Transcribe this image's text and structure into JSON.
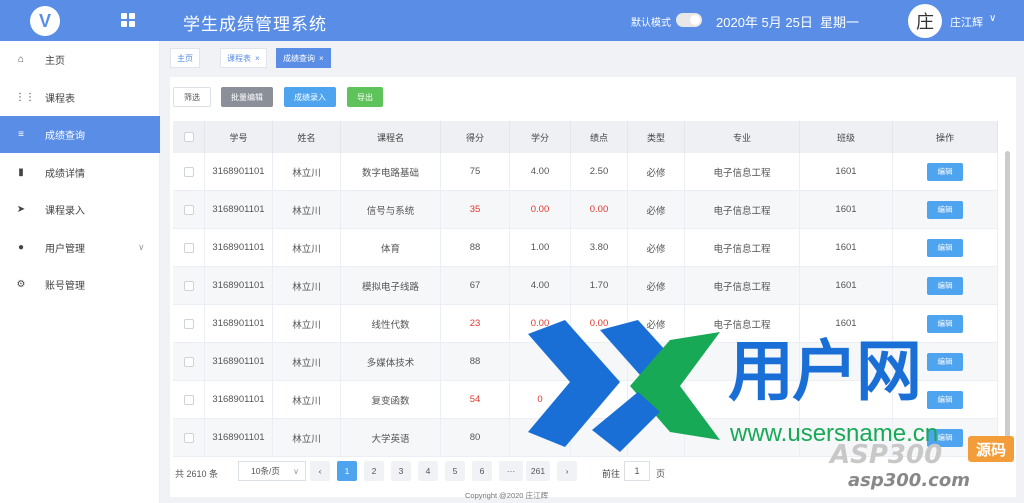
{
  "header": {
    "logo_text": "V",
    "title": "学生成绩管理系统",
    "mode_label": "默认模式",
    "date": "2020年 5月 25日",
    "weekday": "星期一",
    "avatar_char": "庄",
    "username": "庄江辉",
    "chevron": "∨"
  },
  "sidebar": {
    "items": [
      {
        "icon": "⌂",
        "label": "主页",
        "active": false
      },
      {
        "icon": "⋮⋮",
        "label": "课程表",
        "active": false
      },
      {
        "icon": "≡",
        "label": "成绩查询",
        "active": true
      },
      {
        "icon": "▮",
        "label": "成绩详情",
        "active": false
      },
      {
        "icon": "➤",
        "label": "课程录入",
        "active": false
      },
      {
        "icon": "●",
        "label": "用户管理",
        "active": false,
        "chevron": "∨"
      },
      {
        "icon": "⚙",
        "label": "账号管理",
        "active": false
      }
    ]
  },
  "tabs": [
    {
      "label": "主页",
      "closable": false,
      "active": false
    },
    {
      "label": "课程表",
      "closable": true,
      "active": false
    },
    {
      "label": "成绩查询",
      "closable": true,
      "active": true
    }
  ],
  "tab_close": "×",
  "toolbar": {
    "filter": "筛选",
    "batch_edit": "批量编辑",
    "import": "成绩录入",
    "export": "导出"
  },
  "table": {
    "columns": [
      "学号",
      "姓名",
      "课程名",
      "得分",
      "学分",
      "绩点",
      "类型",
      "专业",
      "班级",
      "操作"
    ],
    "edit_label": "编辑",
    "rows": [
      {
        "id": "3168901101",
        "name": "林立川",
        "course": "数字电路基础",
        "score": "75",
        "credit": "4.00",
        "gpa": "2.50",
        "type": "必修",
        "major": "电子信息工程",
        "class": "1601",
        "fail": false
      },
      {
        "id": "3168901101",
        "name": "林立川",
        "course": "信号与系统",
        "score": "35",
        "credit": "0.00",
        "gpa": "0.00",
        "type": "必修",
        "major": "电子信息工程",
        "class": "1601",
        "fail": true
      },
      {
        "id": "3168901101",
        "name": "林立川",
        "course": "体育",
        "score": "88",
        "credit": "1.00",
        "gpa": "3.80",
        "type": "必修",
        "major": "电子信息工程",
        "class": "1601",
        "fail": false
      },
      {
        "id": "3168901101",
        "name": "林立川",
        "course": "模拟电子线路",
        "score": "67",
        "credit": "4.00",
        "gpa": "1.70",
        "type": "必修",
        "major": "电子信息工程",
        "class": "1601",
        "fail": false
      },
      {
        "id": "3168901101",
        "name": "林立川",
        "course": "线性代数",
        "score": "23",
        "credit": "0.00",
        "gpa": "0.00",
        "type": "必修",
        "major": "电子信息工程",
        "class": "1601",
        "fail": true
      },
      {
        "id": "3168901101",
        "name": "林立川",
        "course": "多媒体技术",
        "score": "88",
        "credit": "",
        "gpa": "",
        "type": "",
        "major": "",
        "class": "",
        "fail": false
      },
      {
        "id": "3168901101",
        "name": "林立川",
        "course": "复变函数",
        "score": "54",
        "credit": "0",
        "gpa": "",
        "type": "",
        "major": "",
        "class": "",
        "fail": true
      },
      {
        "id": "3168901101",
        "name": "林立川",
        "course": "大学英语",
        "score": "80",
        "credit": "",
        "gpa": "",
        "type": "",
        "major": "",
        "class": "",
        "fail": false
      }
    ]
  },
  "pagination": {
    "total": "共 2610 条",
    "page_size": "10条/页",
    "prev": "‹",
    "pages": [
      "1",
      "2",
      "3",
      "4",
      "5",
      "6",
      "···",
      "261"
    ],
    "current": "1",
    "next": "›",
    "goto_label": "前往",
    "goto_value": "1",
    "page_word": "页"
  },
  "footer": "Copyright @2020 庄江辉",
  "watermark": {
    "brand": "用户网",
    "url": "www.usersname.cn",
    "asp": "ASP300",
    "badge": "源码",
    "site": "asp300.com"
  }
}
